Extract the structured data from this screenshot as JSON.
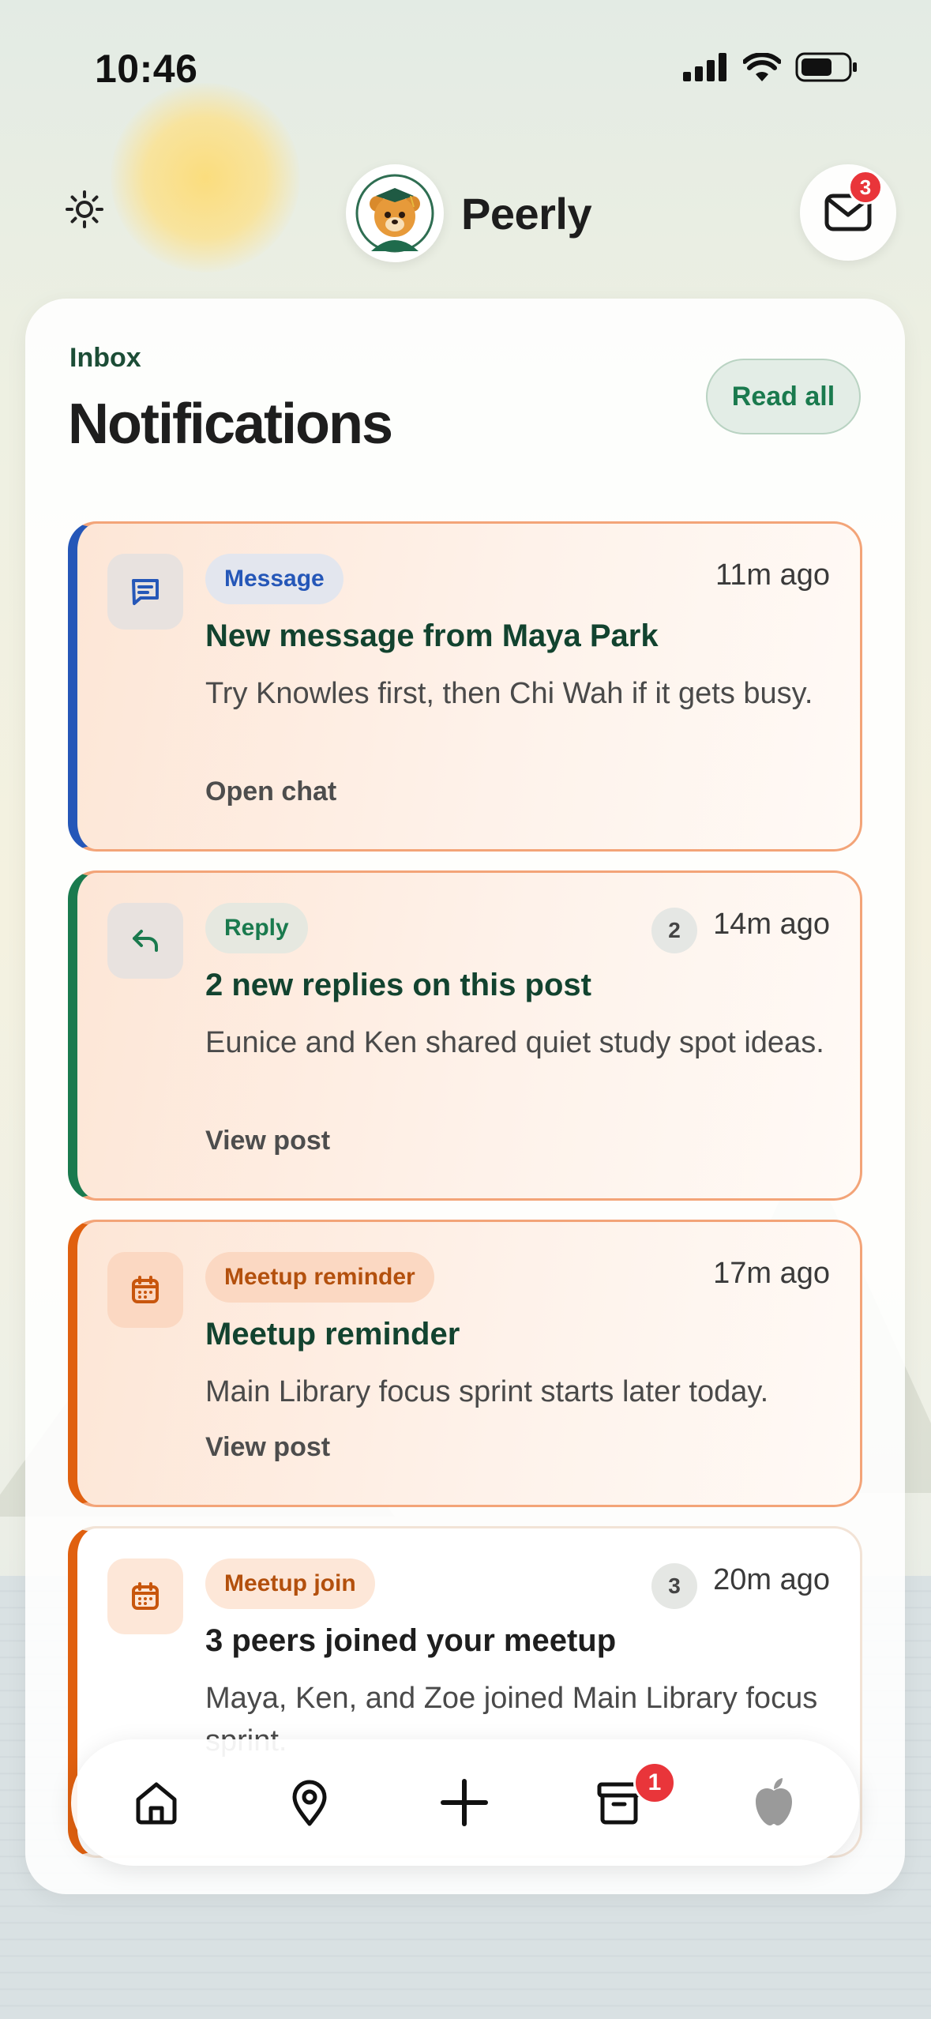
{
  "status_bar": {
    "time": "10:46"
  },
  "header": {
    "brand_name": "Peerly",
    "mail_badge": "3",
    "icons": {
      "theme": "sun-icon",
      "mail": "mail-icon",
      "logo": "bear-graduate-logo"
    }
  },
  "inbox": {
    "section_label": "Inbox",
    "title": "Notifications",
    "read_all_label": "Read all"
  },
  "notifications": [
    {
      "type_label": "Message",
      "icon": "chat-icon",
      "time": "11m ago",
      "title": "New message from Maya Park",
      "body": "Try Knowles first, then Chi Wah if it gets busy.",
      "action": "Open chat",
      "accent": "#2557b8",
      "unread": true
    },
    {
      "type_label": "Reply",
      "icon": "reply-icon",
      "count": "2",
      "time": "14m ago",
      "title": "2 new replies on this post",
      "body": "Eunice and Ken shared quiet study spot ideas.",
      "action": "View post",
      "accent": "#1a7a4e",
      "unread": true
    },
    {
      "type_label": "Meetup reminder",
      "icon": "calendar-icon",
      "time": "17m ago",
      "title": "Meetup reminder",
      "body": "Main Library focus sprint starts later today.",
      "action": "View post",
      "accent": "#e0600f",
      "unread": true
    },
    {
      "type_label": "Meetup join",
      "icon": "calendar-icon",
      "count": "3",
      "time": "20m ago",
      "title": "3 peers joined your meetup",
      "body": "Maya, Ken, and Zoe joined Main Library focus sprint.",
      "accent": "#e0600f",
      "unread": false
    }
  ],
  "bottom_nav": {
    "items": [
      "home-icon",
      "map-pin-icon",
      "plus-icon",
      "archive-icon",
      "apple-icon"
    ],
    "archive_badge": "1"
  },
  "colors": {
    "brand_green": "#1a7a4e",
    "dark_green": "#12432f",
    "badge_red": "#e9353a",
    "unread_border": "#f3a478"
  }
}
